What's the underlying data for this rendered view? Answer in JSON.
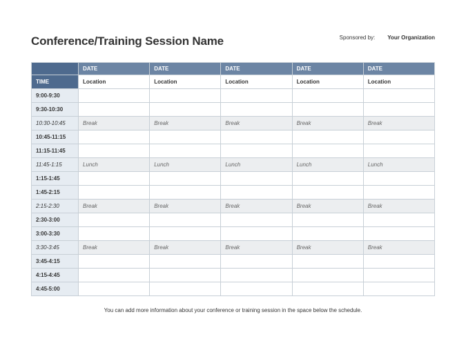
{
  "header": {
    "title": "Conference/Training Session Name",
    "sponsored_by_label": "Sponsored by:",
    "organization": "Your Organization"
  },
  "table": {
    "time_header": "TIME",
    "date_headers": [
      "DATE",
      "DATE",
      "DATE",
      "DATE",
      "DATE"
    ],
    "location_row": {
      "time_cell": "",
      "cells": [
        "Location",
        "Location",
        "Location",
        "Location",
        "Location"
      ]
    },
    "rows": [
      {
        "time": "9:00-9:30",
        "type": "normal",
        "cells": [
          "",
          "",
          "",
          "",
          ""
        ]
      },
      {
        "time": "9:30-10:30",
        "type": "normal",
        "cells": [
          "",
          "",
          "",
          "",
          ""
        ]
      },
      {
        "time": "10:30-10:45",
        "type": "break",
        "cells": [
          "Break",
          "Break",
          "Break",
          "Break",
          "Break"
        ]
      },
      {
        "time": "10:45-11:15",
        "type": "normal",
        "cells": [
          "",
          "",
          "",
          "",
          ""
        ]
      },
      {
        "time": "11:15-11:45",
        "type": "normal",
        "cells": [
          "",
          "",
          "",
          "",
          ""
        ]
      },
      {
        "time": "11:45-1:15",
        "type": "break",
        "cells": [
          "Lunch",
          "Lunch",
          "Lunch",
          "Lunch",
          "Lunch"
        ]
      },
      {
        "time": "1:15-1:45",
        "type": "normal",
        "cells": [
          "",
          "",
          "",
          "",
          ""
        ]
      },
      {
        "time": "1:45-2:15",
        "type": "normal",
        "cells": [
          "",
          "",
          "",
          "",
          ""
        ]
      },
      {
        "time": "2:15-2:30",
        "type": "break",
        "cells": [
          "Break",
          "Break",
          "Break",
          "Break",
          "Break"
        ]
      },
      {
        "time": "2:30-3:00",
        "type": "normal",
        "cells": [
          "",
          "",
          "",
          "",
          ""
        ]
      },
      {
        "time": "3:00-3:30",
        "type": "normal",
        "cells": [
          "",
          "",
          "",
          "",
          ""
        ]
      },
      {
        "time": "3:30-3:45",
        "type": "break",
        "cells": [
          "Break",
          "Break",
          "Break",
          "Break",
          "Break"
        ]
      },
      {
        "time": "3:45-4:15",
        "type": "normal",
        "cells": [
          "",
          "",
          "",
          "",
          ""
        ]
      },
      {
        "time": "4:15-4:45",
        "type": "normal",
        "cells": [
          "",
          "",
          "",
          "",
          ""
        ]
      },
      {
        "time": "4:45-5:00",
        "type": "normal",
        "cells": [
          "",
          "",
          "",
          "",
          ""
        ]
      }
    ]
  },
  "footnote": "You can add more information about your conference or training session in the space below the schedule."
}
